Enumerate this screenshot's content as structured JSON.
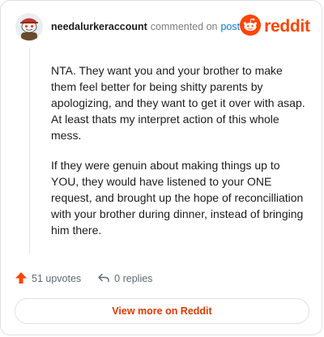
{
  "header": {
    "username": "needalurkeraccount",
    "commented_on": "commented on",
    "post_link": "post",
    "logo_text": "reddit"
  },
  "comment": {
    "paragraphs": [
      "NTA. They want you and your brother to make them feel better for being shitty parents by apologizing, and they want to get it over with asap. At least thats my interpret action of this whole mess.",
      "If they were genuin about making things up to YOU, they would have listened to your ONE request, and brought up the hope of reconcilliation with your brother during dinner, instead of bringing him there."
    ]
  },
  "footer": {
    "upvotes": "51 upvotes",
    "replies": "0 replies",
    "view_more": "View more on Reddit"
  },
  "colors": {
    "brand": "#ff4500",
    "link": "#0079d3",
    "cta": "#d93a00"
  },
  "icons": {
    "avatar": "snoo-avatar-icon",
    "logo": "reddit-snoo-icon",
    "upvote": "upvote-arrow-icon",
    "reply": "reply-arrow-icon"
  }
}
